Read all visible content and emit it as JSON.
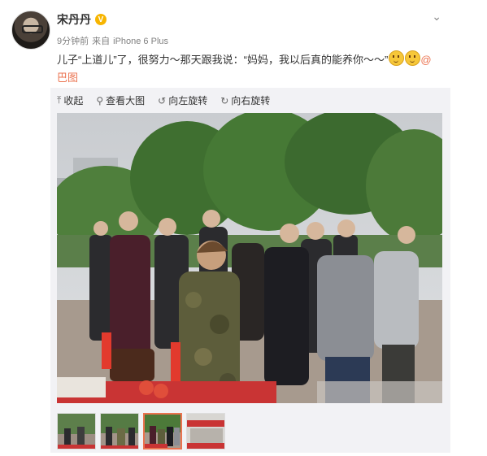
{
  "user": {
    "name": "宋丹丹",
    "verified_badge": "V"
  },
  "post": {
    "time": "9分钟前",
    "source_prefix": "来自",
    "source": "iPhone 6 Plus",
    "text": "儿子“上道儿”了，很努力～那天跟我说：“妈妈，我以后真的能养你～～”",
    "emoji_names": [
      "smile-emoji",
      "smile-emoji"
    ],
    "at_prefix": "@",
    "at_link": "巴图"
  },
  "toolbar": {
    "collapse": "收起",
    "view_large": "查看大图",
    "rotate_left": "向左旋转",
    "rotate_right": "向右旋转"
  },
  "icons": {
    "collapse": "arrow-up-icon",
    "view_large": "magnifier-icon",
    "rotate_left": "rotate-left-icon",
    "rotate_right": "rotate-right-icon",
    "more": "chevron-down-icon"
  },
  "colors": {
    "link": "#eb7350",
    "meta": "#808080",
    "verified": "#f7b500",
    "panel": "#f2f2f5"
  },
  "thumbnails": {
    "count": 4,
    "selected_index": 2
  }
}
